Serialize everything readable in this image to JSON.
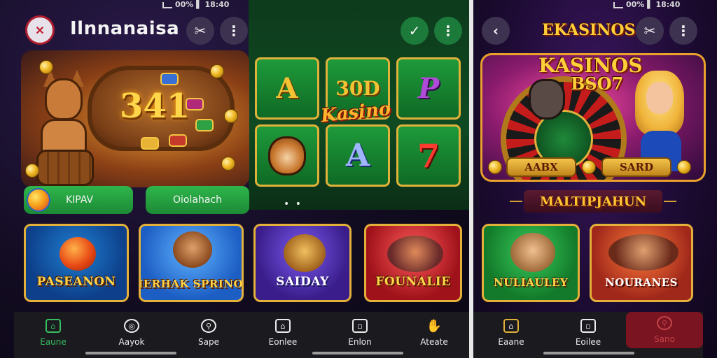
{
  "left_screen": {
    "status_bar": "00% ▌ 18:40",
    "app_title": "Ilnnanaisa",
    "hero": {
      "number": "341"
    },
    "pills": [
      {
        "label": "KIPAV"
      },
      {
        "label": "Oiolahach"
      }
    ],
    "tiles": [
      "A",
      "30D",
      "P",
      "",
      "A",
      "7"
    ],
    "tiles_logo": "Kasino",
    "carousel_dots": "• •",
    "games": [
      {
        "label": "PASEANON"
      },
      {
        "label": "MERHAK SPRINOS"
      },
      {
        "label": "SAIDAY"
      },
      {
        "label": "FOUNALIE"
      }
    ],
    "nav": [
      {
        "label": "Eaune",
        "icon": "home-icon"
      },
      {
        "label": "Aayok",
        "icon": "compass-icon"
      },
      {
        "label": "Sape",
        "icon": "search-icon"
      },
      {
        "label": "Eonlee",
        "icon": "house-outline-icon"
      },
      {
        "label": "Enlon",
        "icon": "note-icon"
      },
      {
        "label": "Ateate",
        "icon": "hand-icon"
      }
    ]
  },
  "right_screen": {
    "status_bar": "00% ▌ 18:40",
    "logo_top": "EKASINOS",
    "hero": {
      "title": "KASINOS",
      "subtitle": "BSO7",
      "buttons": [
        {
          "label": "AABX"
        },
        {
          "label": "SARD"
        }
      ]
    },
    "banner": "MALTIPJAHUN",
    "games": [
      {
        "label": "NULIAULEY"
      },
      {
        "label": "NOURANES"
      }
    ],
    "nav": [
      {
        "label": "Eaane",
        "icon": "home-icon"
      },
      {
        "label": "Eoilee",
        "icon": "note-icon"
      },
      {
        "label": "Sano",
        "icon": "search-icon"
      }
    ]
  },
  "colors": {
    "accent_green": "#36c060",
    "gold": "#ffd54a",
    "card_border": "#e3b03a"
  }
}
